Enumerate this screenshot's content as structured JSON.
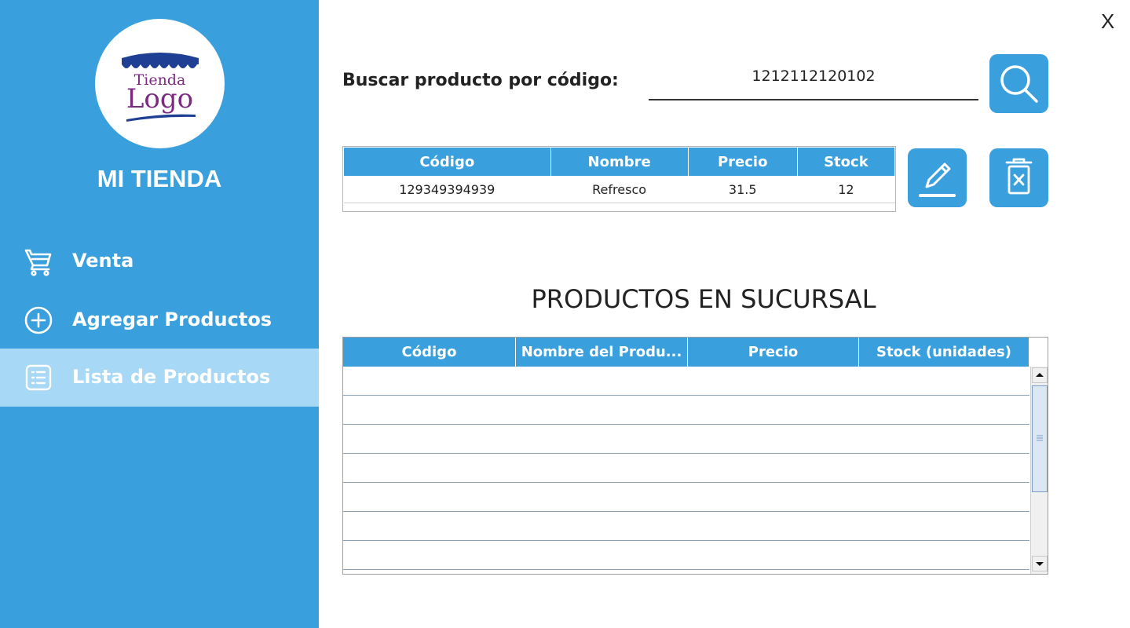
{
  "window": {
    "close_label": "X"
  },
  "sidebar": {
    "logo": {
      "line1": "Tienda",
      "line2": "Logo"
    },
    "store_name": "MI TIENDA",
    "items": [
      {
        "label": "Venta",
        "icon": "cart-icon",
        "active": false
      },
      {
        "label": "Agregar Productos",
        "icon": "plus-circle-icon",
        "active": false
      },
      {
        "label": "Lista de Productos",
        "icon": "list-icon",
        "active": true
      }
    ]
  },
  "search": {
    "label": "Buscar producto por código:",
    "value": "1212112120102",
    "button_icon": "search-icon"
  },
  "result_table": {
    "headers": [
      "Código",
      "Nombre",
      "Precio",
      "Stock"
    ],
    "rows": [
      [
        "129349394939",
        "Refresco",
        "31.5",
        "12"
      ]
    ]
  },
  "actions": {
    "edit_icon": "edit-icon",
    "delete_icon": "delete-icon"
  },
  "section_title": "PRODUCTOS EN SUCURSAL",
  "products_table": {
    "headers": [
      "Código",
      "Nombre del Produ...",
      "Precio",
      "Stock (unidades)"
    ],
    "rows": []
  },
  "colors": {
    "primary": "#3a9fdd",
    "active_nav": "#a7d8f5",
    "logo_purple": "#7a2a80",
    "logo_navy": "#1f3f94"
  }
}
